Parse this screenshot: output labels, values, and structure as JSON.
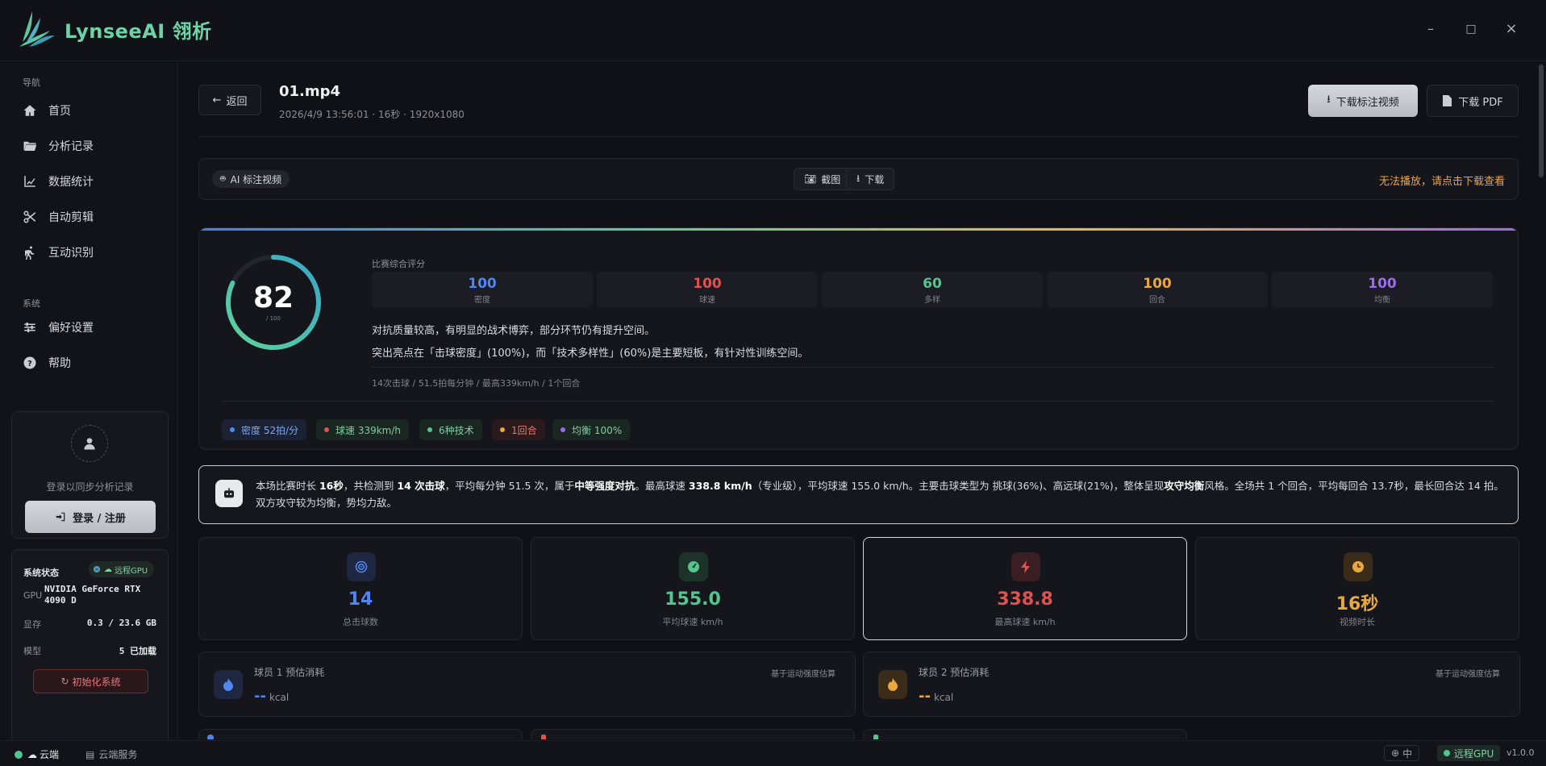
{
  "app": {
    "brand": "LynseeAI 翎析"
  },
  "window_controls": {
    "minimize": "–",
    "maximize": "□",
    "close": "×"
  },
  "sidebar": {
    "nav_section": "导航",
    "nav_items": [
      {
        "label": "首页",
        "icon": "home-icon"
      },
      {
        "label": "分析记录",
        "icon": "folder-icon"
      },
      {
        "label": "数据统计",
        "icon": "chart-icon"
      },
      {
        "label": "自动剪辑",
        "icon": "scissors-icon"
      },
      {
        "label": "互动识别",
        "icon": "run-icon"
      }
    ],
    "system_section": "系统",
    "system_items": [
      {
        "label": "偏好设置",
        "icon": "sliders-icon"
      },
      {
        "label": "帮助",
        "icon": "help-icon"
      }
    ],
    "login": {
      "hint": "登录以同步分析记录",
      "button": "登录 / 注册"
    },
    "system_status": {
      "title": "系统状态",
      "badge": "远程GPU",
      "rows": [
        {
          "key": "GPU",
          "value": "NVIDIA GeForce RTX 4090 D"
        },
        {
          "key": "显存",
          "value": "0.3 / 23.6 GB"
        },
        {
          "key": "模型",
          "value": "5 已加载"
        }
      ],
      "init_button": "初始化系统"
    }
  },
  "header": {
    "back": "返回",
    "file_title": "01.mp4",
    "file_meta": "2026/4/9 13:56:01 · 16秒 · 1920x1080",
    "download_video": "下载标注视频",
    "download_pdf": "下载 PDF"
  },
  "video_bar": {
    "tag": "AI 标注视频",
    "screenshot": "截图",
    "download": "下载",
    "warning": "无法播放，请点击下载查看"
  },
  "score": {
    "label": "比赛综合评分",
    "value": "82",
    "max": "/ 100",
    "metrics": [
      {
        "value": "100",
        "label": "密度",
        "color": "#4f86f0"
      },
      {
        "value": "100",
        "label": "球速",
        "color": "#e0524f"
      },
      {
        "value": "60",
        "label": "多样",
        "color": "#55c48f"
      },
      {
        "value": "100",
        "label": "回合",
        "color": "#e9a83e"
      },
      {
        "value": "100",
        "label": "均衡",
        "color": "#9b6cf0"
      }
    ],
    "summary_line1": "对抗质量较高，有明显的战术博弈，部分环节仍有提升空间。",
    "summary_line2": "突出亮点在「击球密度」(100%)，而「技术多样性」(60%)是主要短板，有针对性训练空间。",
    "stats_line": "14次击球 / 51.5拍每分钟 / 最高339km/h / 1个回合",
    "chips": [
      {
        "label": "密度 52拍/分",
        "color": "#4f86f0",
        "bg": "#1a2233",
        "text": "#7ea6f0"
      },
      {
        "label": "球速 339km/h",
        "color": "#e0524f",
        "bg": "#1a2622",
        "text": "#7ccfa4"
      },
      {
        "label": "6种技术",
        "color": "#55c48f",
        "bg": "#1a2622",
        "text": "#7ccfa4"
      },
      {
        "label": "1回合",
        "color": "#e9a83e",
        "bg": "#2b1a1b",
        "text": "#e07b76"
      },
      {
        "label": "均衡 100%",
        "color": "#9b6cf0",
        "bg": "#1a2622",
        "text": "#7ccfa4"
      }
    ]
  },
  "ai_summary": {
    "t1": "本场比赛时长 ",
    "b1": "16秒",
    "t2": "，共检测到 ",
    "b2": "14 次击球",
    "t3": "，平均每分钟 51.5 次，属于",
    "b3": "中等强度对抗",
    "t4": "。最高球速 ",
    "b4": "338.8 km/h",
    "t5": "（专业级），平均球速 155.0 km/h。主要击球类型为 挑球(36%)、高远球(21%)，整体呈现",
    "b5": "攻守均衡",
    "t6": "风格。全场共 1 个回合，平均每回合 13.7秒，最长回合达 14 拍。双方攻守较为均衡，势均力敌。"
  },
  "stats": [
    {
      "value": "14",
      "label": "总击球数",
      "color": "#4f86f0",
      "icon": "target-icon",
      "icon_bg": "#1e2640"
    },
    {
      "value": "155.0",
      "label": "平均球速 km/h",
      "color": "#55c48f",
      "icon": "gauge-icon",
      "icon_bg": "#1d3329"
    },
    {
      "value": "338.8",
      "label": "最高球速 km/h",
      "color": "#e0524f",
      "icon": "bolt-icon",
      "icon_bg": "#3a1e21"
    },
    {
      "value": "16秒",
      "label": "视频时长",
      "color": "#e9a83e",
      "icon": "clock-icon",
      "icon_bg": "#3a2c18"
    }
  ],
  "energy": [
    {
      "title": "球员 1 预估消耗",
      "note": "基于运动强度估算",
      "value": "--",
      "unit": "kcal",
      "color": "#4f86f0",
      "icon": "flame-blue-icon",
      "icon_bg": "#1e2640"
    },
    {
      "title": "球员 2 预估消耗",
      "note": "基于运动强度估算",
      "value": "--",
      "unit": "kcal",
      "color": "#e9a83e",
      "icon": "flame-orange-icon",
      "icon_bg": "#3a2c18"
    }
  ],
  "statusbar": {
    "cloud": "云端",
    "cloud_service": "云端服务",
    "lang": "中",
    "gpu": "远程GPU",
    "version": "v1.0.0"
  }
}
